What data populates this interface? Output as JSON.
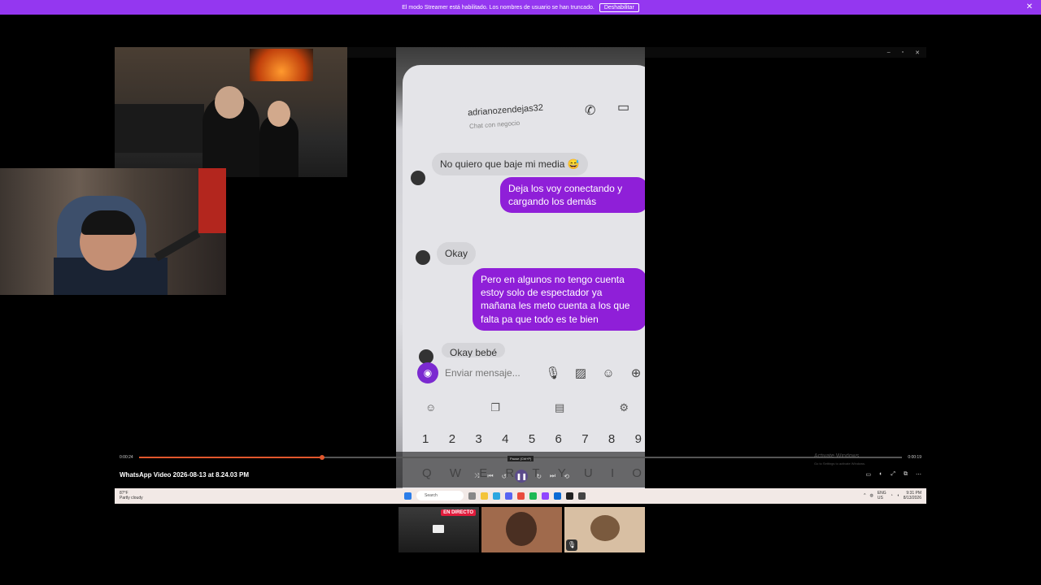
{
  "banner": {
    "message": "El modo Streamer está habilitado. Los nombres de usuario se han truncado.",
    "button": "Deshabilitar",
    "close": "✕"
  },
  "window": {
    "controls": [
      "–",
      "▫",
      "✕"
    ]
  },
  "chat": {
    "username": "adrianozendejas32",
    "subtitle": "Chat con negocio",
    "messages": [
      {
        "from": "them",
        "text": "No quiero que baje mi media 😅"
      },
      {
        "from": "me",
        "text": "Deja los voy conectando y cargando los demás"
      },
      {
        "from": "them",
        "text": "Okay"
      },
      {
        "from": "me",
        "text": "Pero en algunos no tengo cuenta estoy solo de espectador ya mañana les meto cuenta a los que falta pa que todo es te bien"
      },
      {
        "from": "them",
        "text": "Okay bebé"
      }
    ],
    "input_placeholder": "Enviar mensaje...",
    "keyboard_numbers": [
      "1",
      "2",
      "3",
      "4",
      "5",
      "6",
      "7",
      "8",
      "9"
    ],
    "keyboard_letters": [
      "Q",
      "W",
      "E",
      "R",
      "T",
      "Y",
      "U",
      "I",
      "O"
    ]
  },
  "player": {
    "elapsed": "0:00:24",
    "duration": "0:00:19",
    "progress": 0.24,
    "title": "WhatsApp Video 2026-08-13 at 8.24.03 PM",
    "tooltip": "Pause (Ctrl+P)",
    "activate_title": "Activate Windows",
    "activate_sub": "Go to Settings to activate Windows."
  },
  "taskbar": {
    "temp": "87°F",
    "condition": "Partly cloudy",
    "search": "Search",
    "lang1": "ENG",
    "lang2": "US",
    "time": "9:31 PM",
    "date": "8/13/2026"
  },
  "tiles": {
    "live_label": "EN DIRECTO"
  }
}
